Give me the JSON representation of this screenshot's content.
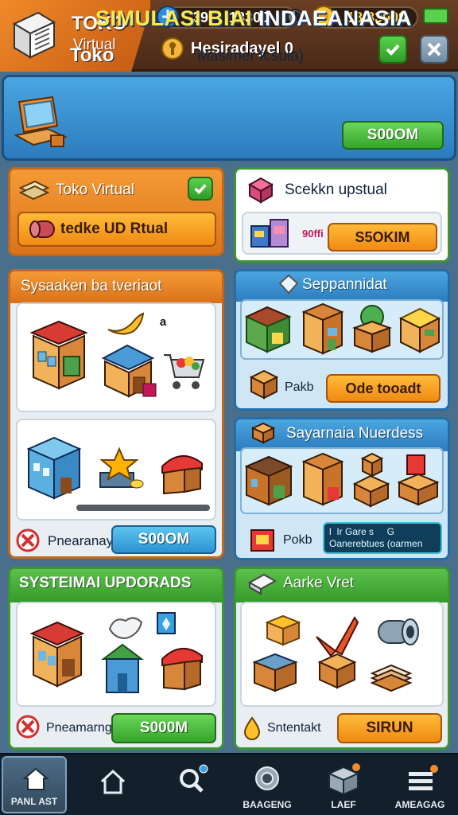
{
  "header": {
    "title": "TOKO",
    "subtitle": "Virtual",
    "stats": {
      "gems": "39",
      "money": "13300",
      "coins": "18.83009"
    },
    "status_label": "Hesiradayel 0"
  },
  "banner": {
    "title_a": "SIMULASI BIAI",
    "title_b": "INDAEANASIA",
    "toko_label": "Toko",
    "subtitle": "Masimer fcsula)",
    "button": "S00OM"
  },
  "left_top": {
    "title": "Toko Virtual",
    "bar_label": "tedke UD Rtual"
  },
  "right_top": {
    "title": "Scekkn upstual",
    "small_text": "90ffi",
    "button": "S5OKIM"
  },
  "left_mid": {
    "title": "Sysaaken ba tveriaot",
    "marker": "a",
    "footer_label": "Pnearanay",
    "button": "S00OM"
  },
  "right_mid1": {
    "title": "Seppannidat",
    "footer_label": "Pakb",
    "button": "Ode tooadt"
  },
  "right_mid2": {
    "title": "Sayarnaia Nuerdess",
    "footer_label": "Pokb",
    "info_line1": "l  Ir Gare s     G",
    "info_line2": "Oanerebtues (oarmen"
  },
  "left_bot": {
    "title": "SYSTEIMAI UPDORADS",
    "footer_label": "Pneamarng",
    "button": "S000M"
  },
  "right_bot": {
    "title": "Aarke Vret",
    "footer_label": "Sntentakt",
    "button": "SIRUN"
  },
  "nav": {
    "items": [
      {
        "label": "PANL AST",
        "icon": "home-icon"
      },
      {
        "label": "",
        "icon": "house-outline-icon"
      },
      {
        "label": "",
        "icon": "search-icon"
      },
      {
        "label": "BAAGENG",
        "icon": "target-icon"
      },
      {
        "label": "LAEF",
        "icon": "box-icon"
      },
      {
        "label": "AMEAGAG",
        "icon": "menu-icon"
      }
    ]
  },
  "colors": {
    "orange": "#e8821e",
    "blue": "#2c7cbf",
    "green": "#3b9531",
    "gold": "#ffd54a",
    "nav_bg": "#13202c"
  }
}
